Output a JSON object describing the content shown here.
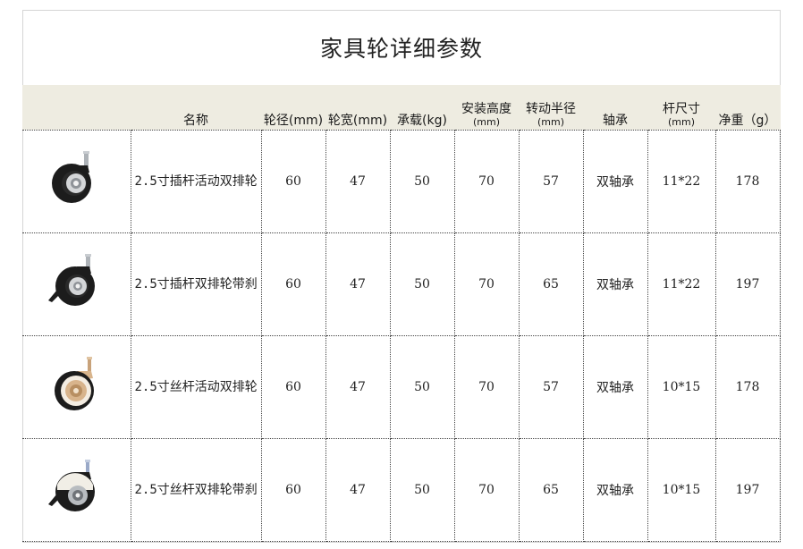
{
  "title": "家具轮详细参数",
  "headers": {
    "name": "名称",
    "wheel_diameter": "轮径(mm)",
    "wheel_width": "轮宽(mm)",
    "load": "承载(kg)",
    "install_height_line1": "安装高度",
    "install_height_line2": "(mm)",
    "turn_radius_line1": "转动半径",
    "turn_radius_line2": "(mm)",
    "bearing": "轴承",
    "stem_size_line1": "杆尺寸",
    "stem_size_line2": "(mm)",
    "net_weight": "净重（g）"
  },
  "rows": [
    {
      "image_icon": "black-caster-stem-icon",
      "name": "2.5寸插杆活动双排轮",
      "wheel_diameter": "60",
      "wheel_width": "47",
      "load": "50",
      "install_height": "70",
      "turn_radius": "57",
      "bearing": "双轴承",
      "stem_size": "11*22",
      "net_weight": "178"
    },
    {
      "image_icon": "black-caster-brake-icon",
      "name": "2.5寸插杆双排轮带刹",
      "wheel_diameter": "60",
      "wheel_width": "47",
      "load": "50",
      "install_height": "70",
      "turn_radius": "65",
      "bearing": "双轴承",
      "stem_size": "11*22",
      "net_weight": "197"
    },
    {
      "image_icon": "gold-caster-thread-icon",
      "name": "2.5寸丝杆活动双排轮",
      "wheel_diameter": "60",
      "wheel_width": "47",
      "load": "50",
      "install_height": "70",
      "turn_radius": "57",
      "bearing": "双轴承",
      "stem_size": "10*15",
      "net_weight": "178"
    },
    {
      "image_icon": "white-caster-brake-icon",
      "name": "2.5寸丝杆双排轮带刹",
      "wheel_diameter": "60",
      "wheel_width": "47",
      "load": "50",
      "install_height": "70",
      "turn_radius": "65",
      "bearing": "双轴承",
      "stem_size": "10*15",
      "net_weight": "197"
    }
  ],
  "colors": {
    "header_band": "#eeece1",
    "tire_black": "#1c1c1c",
    "hub_gold": "#d8b48c",
    "hub_silver": "#b8bcc0"
  }
}
